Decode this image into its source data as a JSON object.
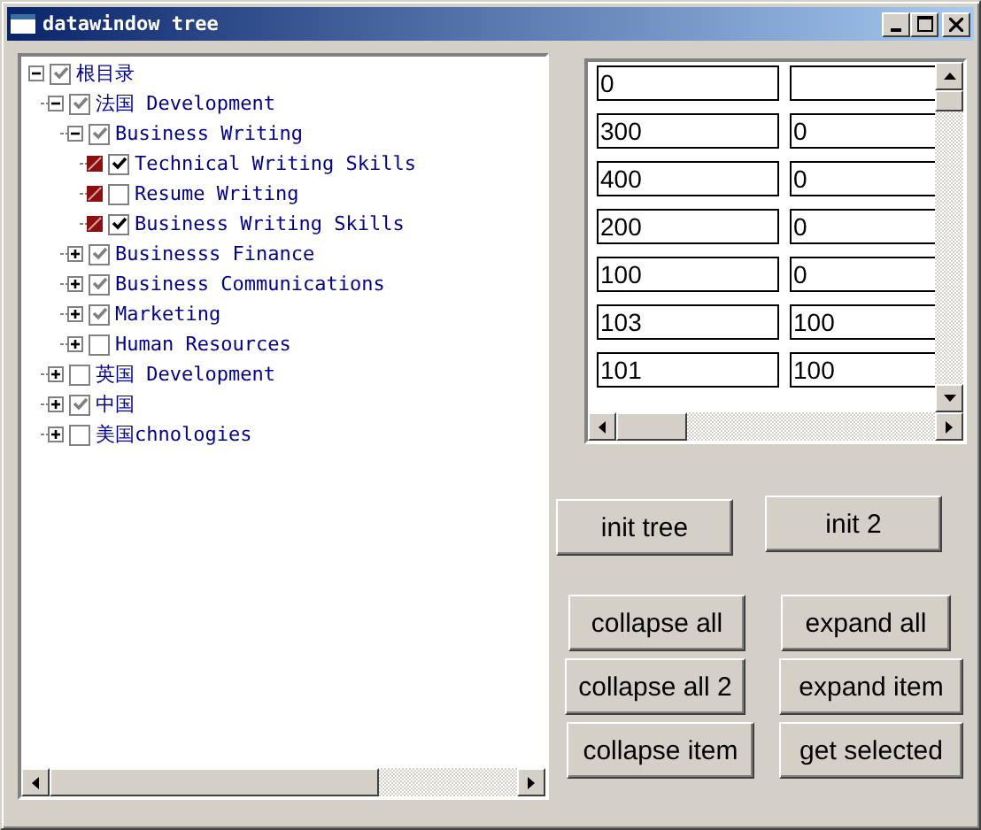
{
  "window": {
    "title": "datawindow tree"
  },
  "tree": [
    {
      "label": "根目录",
      "kind": "branch",
      "checked": true,
      "expanded": true,
      "children": [
        {
          "label": "法国 Development",
          "kind": "branch",
          "checked": true,
          "expanded": true,
          "children": [
            {
              "label": "Business Writing",
              "kind": "branch",
              "checked": true,
              "expanded": true,
              "children": [
                {
                  "label": "Technical Writing Skills",
                  "kind": "leaf",
                  "checked": true
                },
                {
                  "label": "Resume Writing",
                  "kind": "leaf",
                  "checked": false
                },
                {
                  "label": "Business Writing Skills",
                  "kind": "leaf",
                  "checked": true
                }
              ]
            },
            {
              "label": "Businesss Finance",
              "kind": "branch",
              "checked": true,
              "expanded": false
            },
            {
              "label": "Business Communications",
              "kind": "branch",
              "checked": true,
              "expanded": false
            },
            {
              "label": "Marketing",
              "kind": "branch",
              "checked": true,
              "expanded": false
            },
            {
              "label": "Human Resources",
              "kind": "branch",
              "checked": false,
              "expanded": false
            }
          ]
        },
        {
          "label": "英国 Development",
          "kind": "branch",
          "checked": false,
          "expanded": false
        },
        {
          "label": "中国",
          "kind": "branch",
          "checked": true,
          "expanded": false
        },
        {
          "label": "美国chnologies",
          "kind": "branch",
          "checked": false,
          "expanded": false
        }
      ]
    }
  ],
  "grid": {
    "rows": [
      {
        "column_1": "0"
      },
      {
        "column_1": "300",
        "column_2": "0"
      },
      {
        "column_1": "400",
        "column_2": "0"
      },
      {
        "column_1": "200",
        "column_2": "0"
      },
      {
        "column_1": "100",
        "column_2": "0"
      },
      {
        "column_1": "103",
        "column_2": "100"
      },
      {
        "column_1": "101",
        "column_2": "100"
      }
    ]
  },
  "buttons": [
    [
      "init tree",
      "init 2"
    ],
    [
      "collapse all",
      "expand all"
    ],
    [
      "collapse all 2",
      "expand item"
    ],
    [
      "collapse item",
      "get selected"
    ]
  ]
}
